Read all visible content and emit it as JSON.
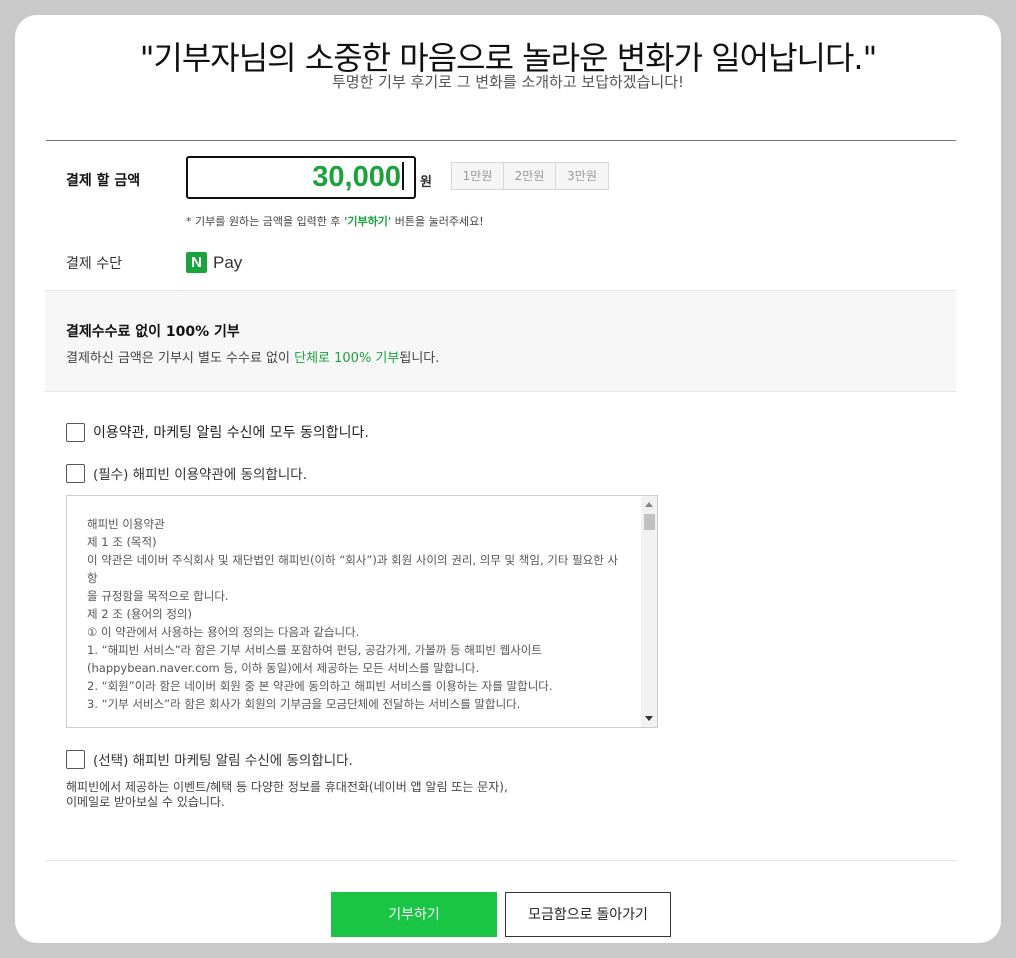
{
  "header": {
    "headline": "\"기부자님의 소중한 마음으로 놀라운 변화가 일어납니다.\"",
    "subhead": "투명한 기부 후기로 그 변화를 소개하고 보답하겠습니다!"
  },
  "payment": {
    "amount_label": "결제 할 금액",
    "amount_value": "30,000",
    "currency": "원",
    "quick_amounts": [
      "1만원",
      "2만원",
      "3만원"
    ],
    "hint_prefix": "* 기부를 원하는 금액을 입력한 후 ",
    "hint_highlight": "'기부하기'",
    "hint_suffix": " 버튼을 눌러주세요!",
    "method_label": "결제 수단",
    "method_icon": "N",
    "method_name": "Pay"
  },
  "fee": {
    "title": "결제수수료 없이 100% 기부",
    "desc_prefix": "결제하신 금액은 기부시 별도 수수료 없이 ",
    "desc_highlight": "단체로 100% 기부",
    "desc_suffix": "됩니다."
  },
  "agreements": {
    "all": "이용약관, 마케팅 알림 수신에 모두 동의합니다.",
    "required": "(필수) 해피빈 이용약관에 동의합니다.",
    "optional": "(선택) 해피빈 마케팅 알림 수신에 동의합니다.",
    "optional_desc_1": "해피빈에서 제공하는 이벤트/혜택 등 다양한 정보를 휴대전화(네이버 앱 알림 또는 문자),",
    "optional_desc_2": "이메일로 받아보실 수 있습니다."
  },
  "terms": {
    "lines": [
      "해피빈 이용약관",
      "",
      "제 1 조 (목적)",
      "이 약관은 네이버 주식회사 및 재단법인 해피빈(이하 “회사”)과 회원 사이의 권리, 의무 및 책임, 기타 필요한 사항",
      "을 규정함을 목적으로 합니다.",
      "",
      "제 2 조 (용어의 정의)",
      "① 이 약관에서 사용하는 용어의 정의는 다음과 같습니다.",
      "1. “해피빈 서비스”라 함은 기부 서비스를 포함하여 펀딩, 공감가게, 가볼까 등 해피빈 웹사이트",
      "(happybean.naver.com 등, 이하 동일)에서 제공하는 모든 서비스를 말합니다.",
      "2. “회원”이라 함은 네이버 회원 중 본 약관에 동의하고 해피빈 서비스를 이용하는 자를 말합니다.",
      "3. “기부 서비스”라 함은 회사가 회원의 기부금을 모금단체에 전달하는 서비스를 말합니다."
    ]
  },
  "buttons": {
    "donate": "기부하기",
    "back": "모금함으로 돌아가기"
  },
  "colors": {
    "accent": "#19a33a",
    "primary_button": "#1ac444"
  }
}
